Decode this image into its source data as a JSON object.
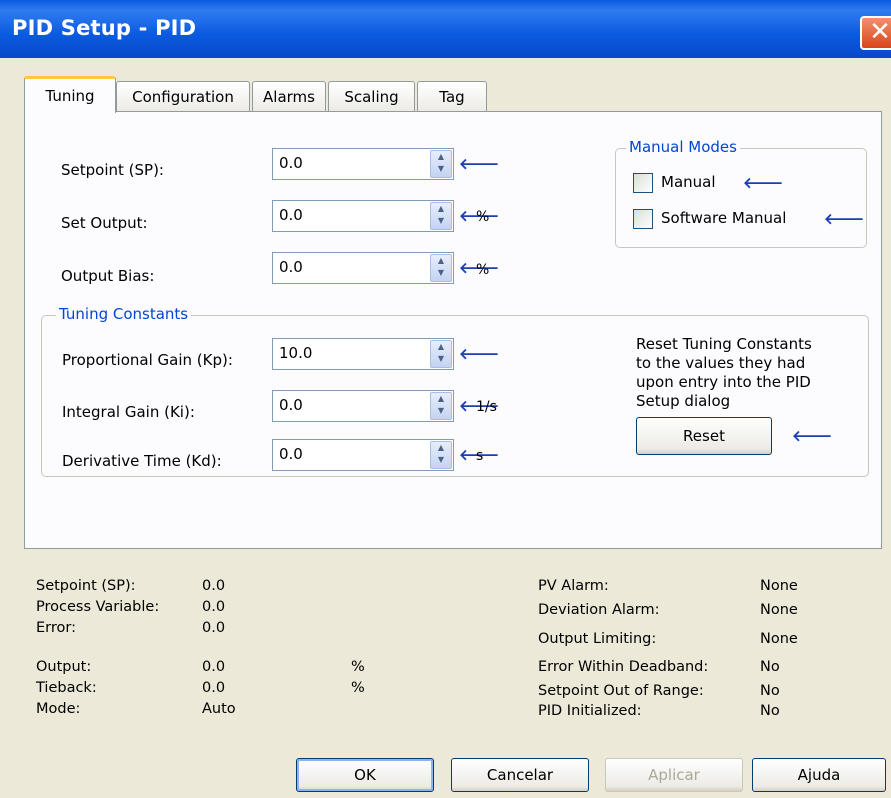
{
  "window": {
    "title": "PID Setup - PID",
    "close_label": "✕"
  },
  "tabs": [
    {
      "label": "Tuning",
      "active": true
    },
    {
      "label": "Configuration"
    },
    {
      "label": "Alarms"
    },
    {
      "label": "Scaling"
    },
    {
      "label": "Tag"
    }
  ],
  "fields": {
    "setpoint": {
      "label": "Setpoint (SP):",
      "value": "0.0",
      "unit": ""
    },
    "set_output": {
      "label": "Set Output:",
      "value": "0.0",
      "unit": "%"
    },
    "output_bias": {
      "label": "Output Bias:",
      "value": "0.0",
      "unit": "%"
    }
  },
  "arrow_glyph": "🡐",
  "manual_modes": {
    "title": "Manual Modes",
    "manual_label": "Manual",
    "software_manual_label": "Software Manual"
  },
  "tuning_constants": {
    "title": "Tuning Constants",
    "kp": {
      "label": "Proportional Gain (Kp):",
      "value": "10.0",
      "unit": ""
    },
    "ki": {
      "label": "Integral Gain (Ki):",
      "value": "0.0",
      "unit": "1/s"
    },
    "kd": {
      "label": "Derivative Time (Kd):",
      "value": "0.0",
      "unit": "s"
    },
    "reset_note_1": "Reset Tuning Constants",
    "reset_note_2": "to the values they had",
    "reset_note_3": "upon entry into the PID",
    "reset_note_4": "Setup dialog",
    "reset_label": "Reset"
  },
  "status_left": [
    {
      "label": "Setpoint (SP):",
      "value": "0.0",
      "unit": ""
    },
    {
      "label": "Process Variable:",
      "value": "0.0",
      "unit": ""
    },
    {
      "label": "Error:",
      "value": "0.0",
      "unit": ""
    },
    {
      "label": "Output:",
      "value": "0.0",
      "unit": "%"
    },
    {
      "label": "Tieback:",
      "value": "0.0",
      "unit": "%"
    },
    {
      "label": "Mode:",
      "value": "Auto",
      "unit": ""
    }
  ],
  "status_right": [
    {
      "label": "PV Alarm:",
      "value": "None"
    },
    {
      "label": "Deviation Alarm:",
      "value": "None"
    },
    {
      "label": "Output Limiting:",
      "value": "None"
    },
    {
      "label": "Error Within Deadband:",
      "value": "No"
    },
    {
      "label": "Setpoint Out of Range:",
      "value": "No"
    },
    {
      "label": "PID Initialized:",
      "value": "No"
    }
  ],
  "buttons": {
    "ok": "OK",
    "cancel": "Cancelar",
    "apply": "Aplicar",
    "help": "Ajuda"
  }
}
